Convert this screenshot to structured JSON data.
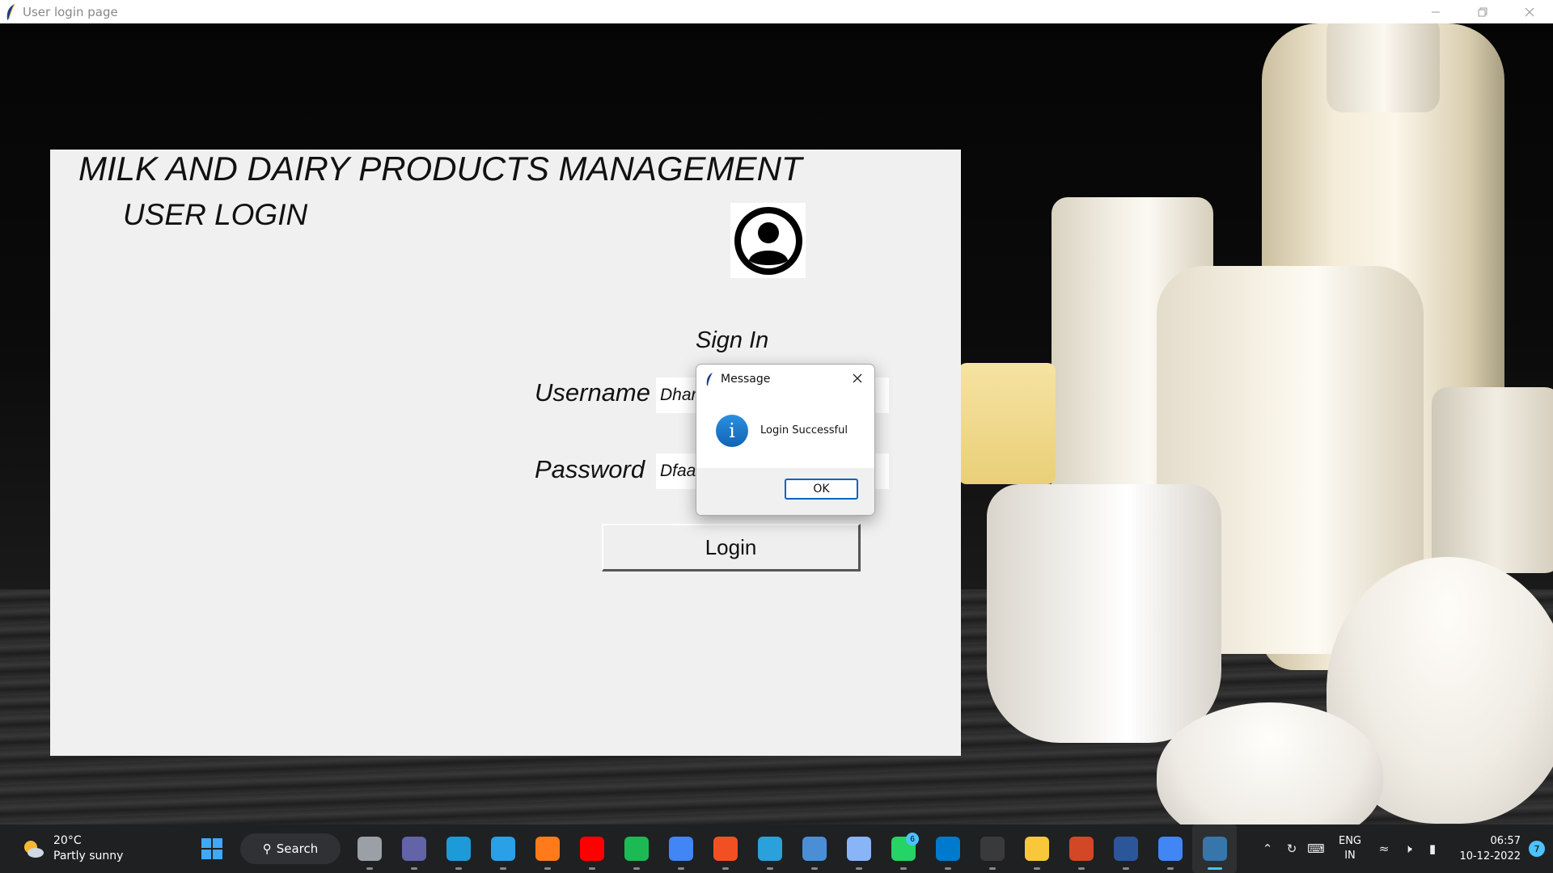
{
  "window": {
    "title": "User login page",
    "controls": [
      "minimize-icon",
      "restore-icon",
      "close-icon"
    ]
  },
  "app": {
    "heading": "MILK AND DAIRY PRODUCTS MANAGEMENT",
    "subheading": "USER LOGIN",
    "signin_label": "Sign In",
    "username_label": "Username",
    "password_label": "Password",
    "username_value": "Dhar",
    "password_value": "Dfaa",
    "login_button": "Login"
  },
  "dialog": {
    "title": "Message",
    "message": "Login Successful",
    "ok_label": "OK",
    "icon": "info-icon"
  },
  "taskbar": {
    "weather": {
      "temp": "20°C",
      "condition": "Partly sunny"
    },
    "search_label": "Search",
    "apps": [
      {
        "name": "task-view",
        "color": "#9aa0a6"
      },
      {
        "name": "teams",
        "color": "#6264a7"
      },
      {
        "name": "edge",
        "color": "#1d9bd8"
      },
      {
        "name": "help",
        "color": "#2aa0e6"
      },
      {
        "name": "firefox",
        "color": "#ff7a1a"
      },
      {
        "name": "youtube",
        "color": "#ff0000"
      },
      {
        "name": "spotify",
        "color": "#1db954"
      },
      {
        "name": "chrome",
        "color": "#4285f4"
      },
      {
        "name": "store",
        "color": "#f25022"
      },
      {
        "name": "telegram",
        "color": "#2aa1da"
      },
      {
        "name": "notepad",
        "color": "#4a8fd6"
      },
      {
        "name": "recycle",
        "color": "#8ab4f8"
      },
      {
        "name": "whatsapp",
        "color": "#25d366",
        "badge": "6"
      },
      {
        "name": "vscode",
        "color": "#007acc"
      },
      {
        "name": "terminal",
        "color": "#3a3a3a"
      },
      {
        "name": "file-explorer",
        "color": "#f8c83a"
      },
      {
        "name": "powerpoint",
        "color": "#d24726"
      },
      {
        "name": "word",
        "color": "#2b579a"
      },
      {
        "name": "chrome-profile",
        "color": "#4285f4"
      },
      {
        "name": "python",
        "color": "#3776ab",
        "active": true
      }
    ],
    "tray": {
      "lang_top": "ENG",
      "lang_bottom": "IN",
      "time": "06:57",
      "date": "10-12-2022",
      "notifications": "7"
    }
  }
}
